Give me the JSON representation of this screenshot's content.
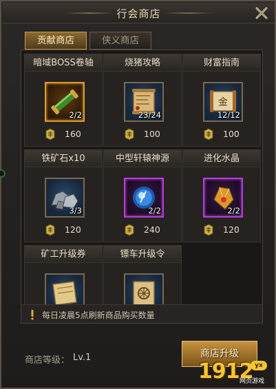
{
  "window": {
    "title": "行会商店"
  },
  "tabs": [
    {
      "label": "贡献商店",
      "active": true
    },
    {
      "label": "侠义商店",
      "active": false
    }
  ],
  "items": [
    {
      "name": "暗域BOSS卷轴",
      "count": "2/2",
      "price": "160",
      "rarity": "orange",
      "icon": "scroll-green-icon"
    },
    {
      "name": "烧猪攻略",
      "count": "23/24",
      "price": "100",
      "rarity": "blue",
      "icon": "parchment-map-icon"
    },
    {
      "name": "财富指南",
      "count": "12/12",
      "price": "100",
      "rarity": "blue",
      "icon": "gold-scroll-icon"
    },
    {
      "name": "铁矿石x10",
      "count": "3/3",
      "price": "120",
      "rarity": "blue",
      "icon": "iron-ore-icon"
    },
    {
      "name": "中型轩辕神源",
      "count": "2/2",
      "price": "240",
      "rarity": "purple",
      "icon": "blue-orb-icon"
    },
    {
      "name": "进化水晶",
      "count": "2/2",
      "price": "120",
      "rarity": "purple",
      "icon": "golden-crystal-icon"
    },
    {
      "name": "矿工升级券",
      "count": "",
      "price": "",
      "rarity": "blue",
      "icon": "ticket-scroll-icon"
    },
    {
      "name": "镖车升级令",
      "count": "",
      "price": "",
      "rarity": "blue",
      "icon": "wheel-scroll-icon"
    }
  ],
  "notice": {
    "text": "每日凌晨5点刷新商品购买数量"
  },
  "footer": {
    "level_label": "商店等级：",
    "level_value": "Lv.1",
    "upgrade_label": "商店升级"
  },
  "watermark": {
    "text": "1912",
    "badge": "yx",
    "sub": "网页游戏"
  },
  "colors": {
    "accent": "#c59440",
    "orange_frame": "#e09a2a",
    "purple_frame": "#b63cdc",
    "blue_frame": "#7a6a50"
  }
}
